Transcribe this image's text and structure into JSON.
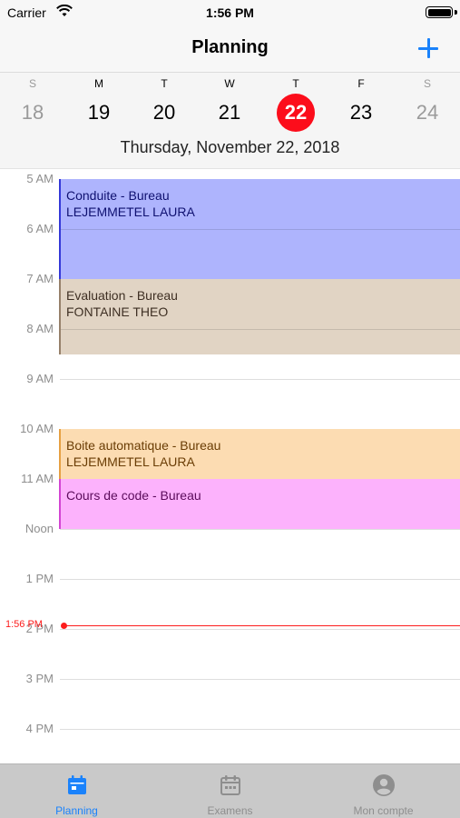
{
  "status_bar": {
    "carrier": "Carrier",
    "time": "1:56 PM"
  },
  "nav": {
    "title": "Planning",
    "add_icon": "plus-icon"
  },
  "week": {
    "days": [
      {
        "letter": "S",
        "number": "18",
        "weekend": true
      },
      {
        "letter": "M",
        "number": "19",
        "weekend": false
      },
      {
        "letter": "T",
        "number": "20",
        "weekend": false
      },
      {
        "letter": "W",
        "number": "21",
        "weekend": false
      },
      {
        "letter": "T",
        "number": "22",
        "weekend": false,
        "selected": true
      },
      {
        "letter": "F",
        "number": "23",
        "weekend": false
      },
      {
        "letter": "S",
        "number": "24",
        "weekend": true
      }
    ],
    "selected_date": "Thursday, November 22, 2018",
    "selected_color": "#fc0d1b"
  },
  "timeline": {
    "hours": [
      "5 AM",
      "6 AM",
      "7 AM",
      "8 AM",
      "9 AM",
      "10 AM",
      "11 AM",
      "Noon",
      "1 PM",
      "2 PM",
      "3 PM",
      "4 PM"
    ],
    "current_time_label": "1:56 PM",
    "current_time_color": "#fc1d1d"
  },
  "events": [
    {
      "title": "Conduite - Bureau",
      "subtitle": "LEJEMMETEL LAURA",
      "start": "5:00 AM",
      "end": "7:00 AM",
      "bg": "#aeb4fd",
      "border": "#3438d8",
      "text": "#0f1170"
    },
    {
      "title": "Evaluation - Bureau",
      "subtitle": "FONTAINE THEO",
      "start": "7:00 AM",
      "end": "8:30 AM",
      "bg": "#e1d4c4",
      "border": "#96806a",
      "text": "#3e2f23"
    },
    {
      "title": "Boite automatique - Bureau",
      "subtitle": "LEJEMMETEL LAURA",
      "start": "10:00 AM",
      "end": "11:00 AM",
      "bg": "#fcdcb2",
      "border": "#e6a042",
      "text": "#6a3d05"
    },
    {
      "title": "Cours de code - Bureau",
      "subtitle": "",
      "start": "11:00 AM",
      "end": "12:00 PM",
      "bg": "#fcb2fc",
      "border": "#d345d3",
      "text": "#5c0c5c"
    }
  ],
  "tabs": [
    {
      "label": "Planning",
      "icon": "calendar-icon",
      "active": true
    },
    {
      "label": "Examens",
      "icon": "calendar-icon",
      "active": false
    },
    {
      "label": "Mon compte",
      "icon": "user-icon",
      "active": false
    }
  ],
  "colors": {
    "accent": "#1a82fb",
    "tab_bar_bg": "#c9c9c9"
  }
}
